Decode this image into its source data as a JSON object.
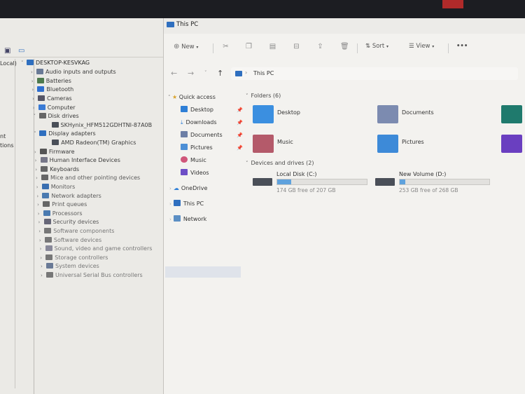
{
  "device_manager": {
    "left_pane": [
      "Local)",
      "nt",
      "tions"
    ],
    "root": "DESKTOP-KESVKAG",
    "items": [
      {
        "label": "Audio inputs and outputs",
        "expanded": false
      },
      {
        "label": "Batteries",
        "expanded": false
      },
      {
        "label": "Bluetooth",
        "expanded": false
      },
      {
        "label": "Cameras",
        "expanded": false
      },
      {
        "label": "Computer",
        "expanded": false
      },
      {
        "label": "Disk drives",
        "expanded": true,
        "child": "SKHynix_HFM512GDHTNI-87A0B"
      },
      {
        "label": "Display adapters",
        "expanded": true,
        "child": "AMD Radeon(TM) Graphics"
      },
      {
        "label": "Firmware",
        "expanded": false
      },
      {
        "label": "Human Interface Devices",
        "expanded": false
      },
      {
        "label": "Keyboards",
        "expanded": false
      },
      {
        "label": "Mice and other pointing devices",
        "expanded": false
      },
      {
        "label": "Monitors",
        "expanded": false
      },
      {
        "label": "Network adapters",
        "expanded": false
      },
      {
        "label": "Print queues",
        "expanded": false
      },
      {
        "label": "Processors",
        "expanded": false
      },
      {
        "label": "Security devices",
        "expanded": false
      },
      {
        "label": "Software components",
        "expanded": false
      },
      {
        "label": "Software devices",
        "expanded": false
      },
      {
        "label": "Sound, video and game controllers",
        "expanded": false
      },
      {
        "label": "Storage controllers",
        "expanded": false
      },
      {
        "label": "System devices",
        "expanded": false
      },
      {
        "label": "Universal Serial Bus controllers",
        "expanded": false
      }
    ]
  },
  "explorer": {
    "title": "This PC",
    "toolbar": {
      "new_label": "New",
      "sort_label": "Sort",
      "view_label": "View",
      "more": "•••"
    },
    "address": "This PC",
    "nav": {
      "quick_access": "Quick access",
      "pinned": [
        "Desktop",
        "Downloads",
        "Documents",
        "Pictures"
      ],
      "unpinned": [
        "Music",
        "Videos"
      ],
      "onedrive": "OneDrive",
      "this_pc": "This PC",
      "network": "Network"
    },
    "folders_header": "Folders (6)",
    "folders": [
      "Desktop",
      "Documents",
      "Music",
      "Pictures"
    ],
    "drives_header": "Devices and drives (2)",
    "drives": [
      {
        "name": "Local Disk (C:)",
        "free_text": "174 GB free of 207 GB",
        "used_fraction": 0.16
      },
      {
        "name": "New Volume (D:)",
        "free_text": "253 GB free of 268 GB",
        "used_fraction": 0.06
      }
    ]
  }
}
